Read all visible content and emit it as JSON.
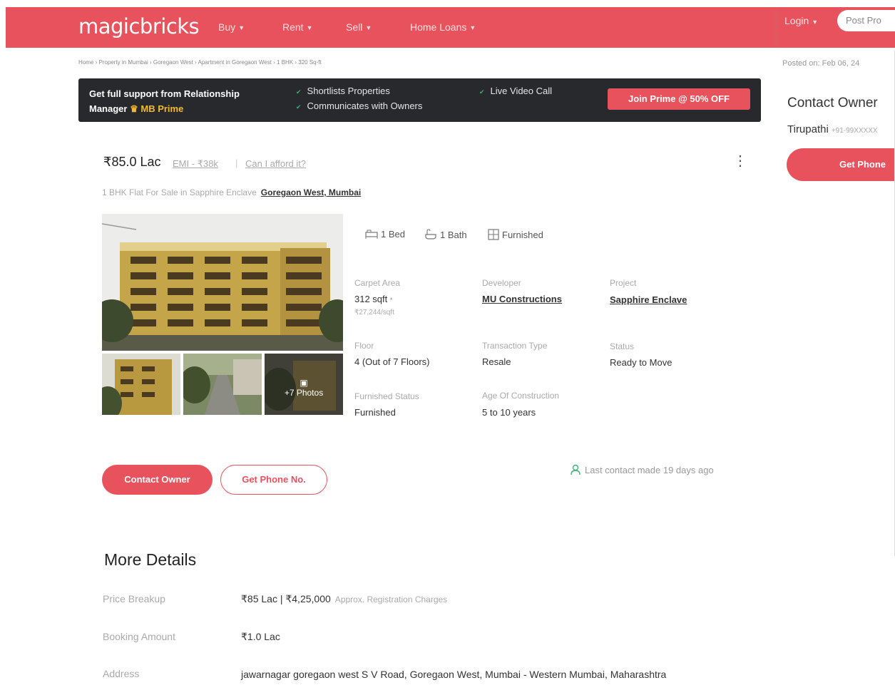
{
  "header": {
    "logo": "magicbricks",
    "nav": [
      {
        "label": "Buy"
      },
      {
        "label": "Rent"
      },
      {
        "label": "Sell"
      },
      {
        "label": "Home Loans"
      }
    ],
    "login": "Login",
    "post_property": "Post Pro"
  },
  "breadcrumb": "Home › Property in Mumbai › Goregaon West › Apartment in Goregaon West › 1 BHK › 320 Sq-ft",
  "posted_on": "Posted on: Feb 06, 24",
  "banner": {
    "title_line1": "Get full support from Relationship",
    "title_line2_prefix": "Manager",
    "title_line2_brand": "MB Prime",
    "features": [
      "Shortlists Properties",
      "Communicates with Owners",
      "Live Video Call"
    ],
    "cta": "Join Prime @ 50% OFF"
  },
  "side": {
    "title": "Contact Owner",
    "owner_name": "Tirupathi",
    "owner_phone": "+91-99XXXXX",
    "cta": "Get Phone"
  },
  "listing": {
    "price": "₹85.0 Lac",
    "emi": "EMI - ₹38k",
    "separator": "|",
    "afford": "Can I afford it?",
    "subtitle_prefix": "1 BHK Flat For Sale in Sapphire Enclave",
    "location": "Goregaon West, Mumbai",
    "more_photos": "+7 Photos",
    "amenities": [
      {
        "label": "1 Bed"
      },
      {
        "label": "1 Bath"
      },
      {
        "label": "Furnished"
      }
    ],
    "details": {
      "carpet_label": "Carpet Area",
      "carpet_value": "312 sqft",
      "carpet_sub": "₹27,244/sqft",
      "developer_label": "Developer",
      "developer_value": "MU Constructions",
      "project_label": "Project",
      "project_value": "Sapphire Enclave",
      "floor_label": "Floor",
      "floor_value": "4 (Out of 7 Floors)",
      "transaction_label": "Transaction Type",
      "transaction_value": "Resale",
      "status_label": "Status",
      "status_value": "Ready to Move",
      "furnished_label": "Furnished Status",
      "furnished_value": "Furnished",
      "age_label": "Age Of Construction",
      "age_value": "5 to 10 years"
    },
    "contact_btn": "Contact Owner",
    "phone_btn": "Get Phone No.",
    "last_contact": "Last contact made 19 days ago"
  },
  "more_details": {
    "title": "More Details",
    "price_label": "Price Breakup",
    "price_value": "₹85 Lac | ₹4,25,000",
    "price_note": "Approx. Registration Charges",
    "booking_label": "Booking Amount",
    "booking_value": "₹1.0 Lac",
    "address_label": "Address",
    "address_value": "jawarnagar goregaon west S V Road, Goregaon West, Mumbai - Western Mumbai, Maharashtra"
  },
  "colors": {
    "brand": "#e8525c",
    "banner_bg": "#28292d",
    "gold": "#f5b82e",
    "tick": "#3bb273"
  }
}
